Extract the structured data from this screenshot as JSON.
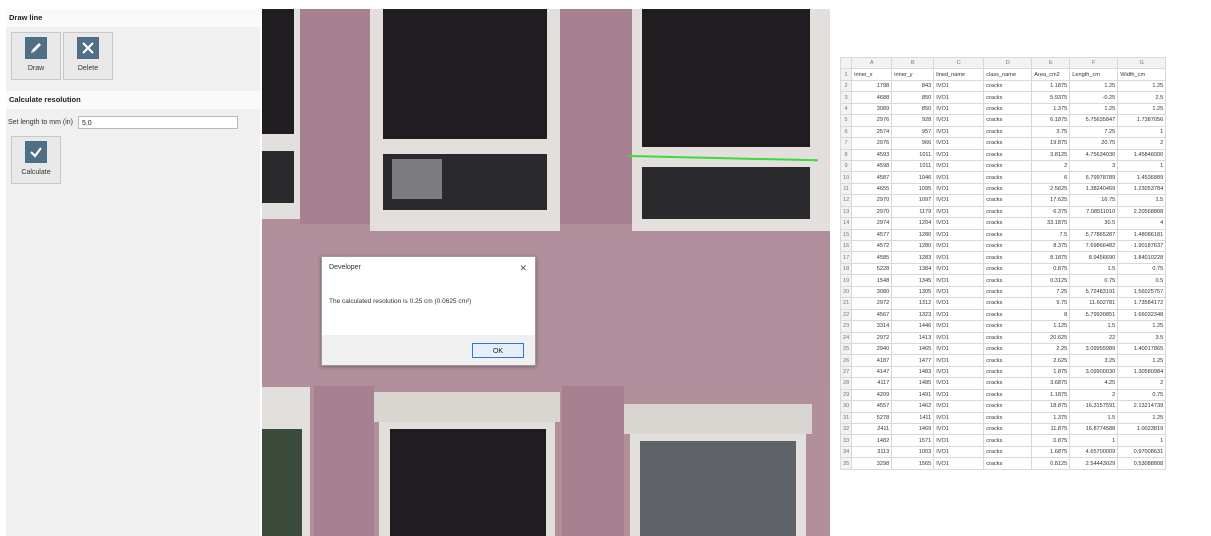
{
  "draw_line": {
    "section_title": "Draw line",
    "draw_label": "Draw",
    "delete_label": "Delete"
  },
  "calculate_resolution": {
    "section_title": "Calculate resolution",
    "set_length_label": "Set length to mm (in)",
    "length_value": "5.0",
    "calculate_label": "Calculate"
  },
  "dialog": {
    "title": "Developer",
    "close": "✕",
    "message": "The calculated resolution is 0.25 cm (0.0625 cm²)",
    "ok_label": "OK"
  },
  "colors": {
    "accent": "#4f6f86",
    "crack_line": "#3adb3a",
    "dialog_ok_border": "#2b79d4"
  },
  "spreadsheet": {
    "col_letters": [
      "A",
      "B",
      "C",
      "D",
      "E",
      "F",
      "G"
    ],
    "headers": [
      "inner_x",
      "inner_y",
      "lined_name",
      "class_name",
      "Area_cm2",
      "Length_cm",
      "Width_cm"
    ],
    "rows": [
      [
        "1798",
        "843",
        "IVO1",
        "cracks",
        "1.1875",
        "1.25",
        "1.25"
      ],
      [
        "4688",
        "850",
        "IVO1",
        "cracks",
        "5.9375",
        "-0.25",
        "2.5"
      ],
      [
        "3089",
        "850",
        "IVO1",
        "cracks",
        "1.375",
        "1.25",
        "1.25"
      ],
      [
        "2976",
        "928",
        "IVO1",
        "cracks",
        "6.1875",
        "5.75635847",
        "1.7387056"
      ],
      [
        "2574",
        "957",
        "IVO1",
        "cracks",
        "3.75",
        "7.25",
        "1"
      ],
      [
        "2976",
        "966",
        "IVO1",
        "cracks",
        "19.875",
        "20.75",
        "2"
      ],
      [
        "4593",
        "1011",
        "IVO1",
        "cracks",
        "3.8125",
        "4.75634030",
        "1.45846000"
      ],
      [
        "4598",
        "1011",
        "IVO1",
        "cracks",
        "2",
        "3",
        "1"
      ],
      [
        "4587",
        "1046",
        "IVO1",
        "cracks",
        "6",
        "6.79978789",
        "1.4536889"
      ],
      [
        "4655",
        "1095",
        "IVO1",
        "cracks",
        "2.5625",
        "1.38240469",
        "1.23053784"
      ],
      [
        "2970",
        "1097",
        "IVO1",
        "cracks",
        "17.625",
        "16.75",
        "1.5"
      ],
      [
        "2970",
        "1179",
        "IVO1",
        "cracks",
        "6.375",
        "7.08511010",
        "2.20568808"
      ],
      [
        "2974",
        "1204",
        "IVO1",
        "cracks",
        "33.1875",
        "30.5",
        "4"
      ],
      [
        "4577",
        "1280",
        "IVO1",
        "cracks",
        "7.5",
        "5.77865287",
        "1.48086181"
      ],
      [
        "4572",
        "1280",
        "IVO1",
        "cracks",
        "8.375",
        "7.69866482",
        "1.90187637"
      ],
      [
        "4585",
        "1283",
        "IVO1",
        "cracks",
        "8.1875",
        "8.9456690",
        "1.84010228"
      ],
      [
        "5228",
        "1384",
        "IVO1",
        "cracks",
        "0.875",
        "1.5",
        "0.75"
      ],
      [
        "1548",
        "1345",
        "IVO1",
        "cracks",
        "0.3125",
        "0.75",
        "0.5"
      ],
      [
        "3080",
        "1305",
        "IVO1",
        "cracks",
        "7.25",
        "5.72483191",
        "1.56025757"
      ],
      [
        "2972",
        "1312",
        "IVO1",
        "cracks",
        "9.75",
        "11.602781",
        "1.73584172"
      ],
      [
        "4567",
        "1323",
        "IVO1",
        "cracks",
        "8",
        "5.79930851",
        "1.66032348"
      ],
      [
        "3314",
        "1446",
        "IVO1",
        "cracks",
        "1.125",
        "1.5",
        "1.25"
      ],
      [
        "2972",
        "1413",
        "IVO1",
        "cracks",
        "20.625",
        "22",
        "3.5"
      ],
      [
        "2940",
        "1465",
        "IVO1",
        "cracks",
        "2.25",
        "3.09955989",
        "1.40017865"
      ],
      [
        "4187",
        "1477",
        "IVO1",
        "cracks",
        "2.625",
        "3.25",
        "1.25"
      ],
      [
        "4147",
        "1483",
        "IVO1",
        "cracks",
        "1.875",
        "3.09900030",
        "1.30580984"
      ],
      [
        "4117",
        "1485",
        "IVO1",
        "cracks",
        "3.6875",
        "4.25",
        "2"
      ],
      [
        "4209",
        "1491",
        "IVO1",
        "cracks",
        "1.1875",
        "2",
        "0.75"
      ],
      [
        "4557",
        "1462",
        "IVO1",
        "cracks",
        "18.875",
        "16.3157591",
        "2.13214739"
      ],
      [
        "5278",
        "1411",
        "IVO1",
        "cracks",
        "1.375",
        "1.5",
        "1.25"
      ],
      [
        "2411",
        "1469",
        "IVO1",
        "cracks",
        "11.875",
        "16.8774588",
        "1.0023819"
      ],
      [
        "1482",
        "1571",
        "IVO1",
        "cracks",
        "0.875",
        "1",
        "1"
      ],
      [
        "3113",
        "1003",
        "IVO1",
        "cracks",
        "1.6875",
        "4.65700009",
        "0.97008631"
      ],
      [
        "3298",
        "1565",
        "IVO1",
        "cracks",
        "0.8125",
        "2.54443029",
        "0.53088808"
      ]
    ]
  }
}
